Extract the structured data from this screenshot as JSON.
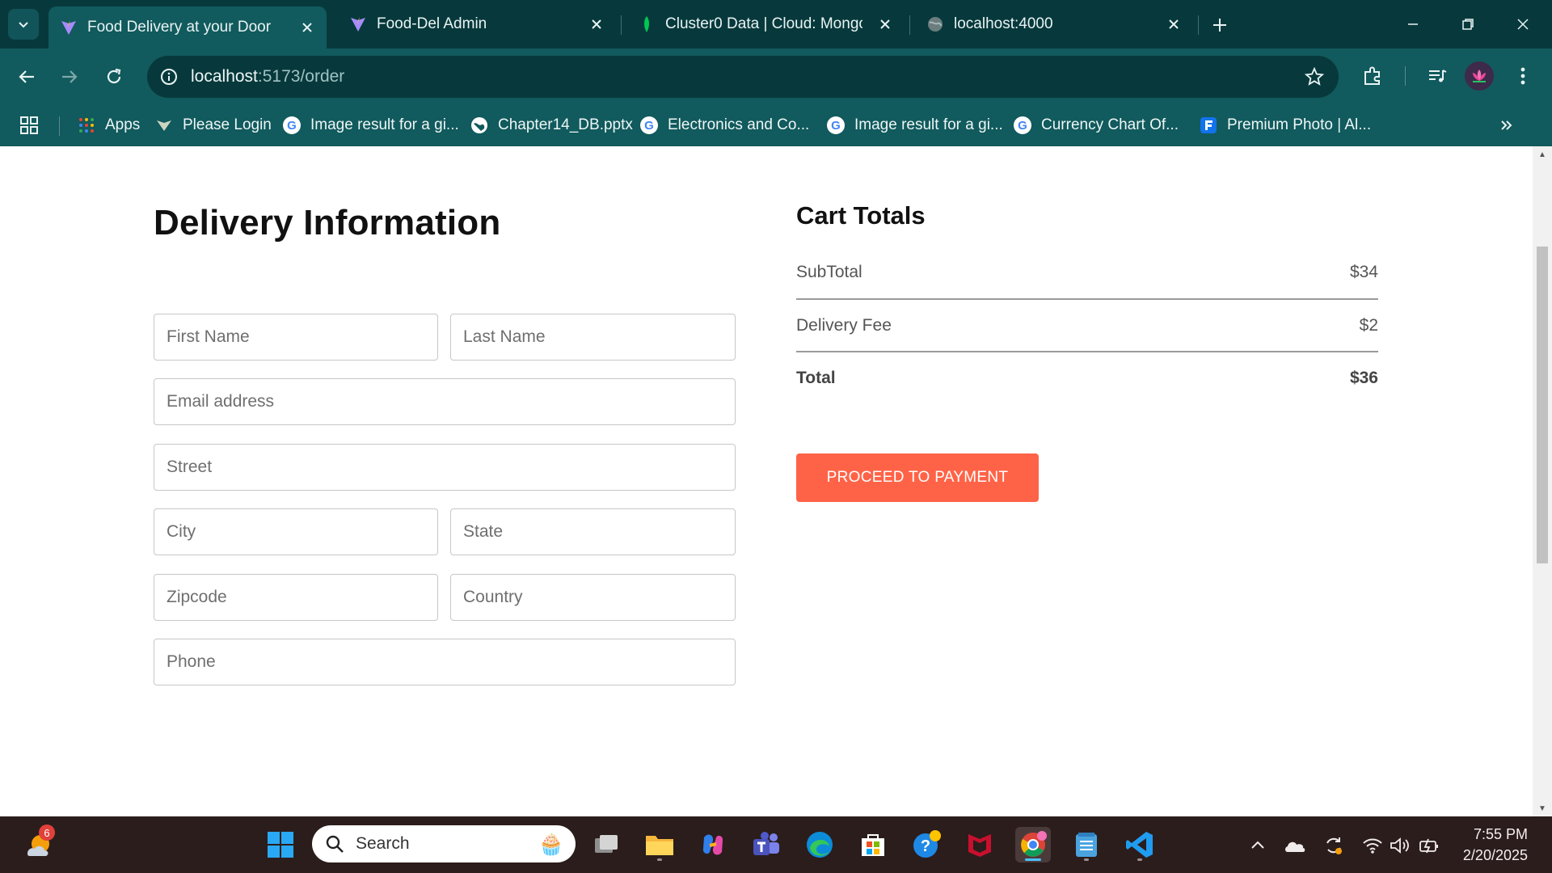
{
  "browser": {
    "tabs": [
      {
        "title": "Food Delivery at your Door",
        "active": true,
        "favicon": "vite-icon"
      },
      {
        "title": "Food-Del Admin",
        "active": false,
        "favicon": "vite-icon"
      },
      {
        "title": "Cluster0 Data | Cloud: MongoDB",
        "active": false,
        "favicon": "mongodb-leaf-icon"
      },
      {
        "title": "localhost:4000",
        "active": false,
        "favicon": "globe-icon"
      }
    ],
    "address": {
      "host": "localhost",
      "path": ":5173/order"
    },
    "bookmarks": [
      {
        "label": "Apps",
        "icon": "apps-grid-icon"
      },
      {
        "label": "Please Login",
        "icon": "vite-icon"
      },
      {
        "label": "Image result for a gi...",
        "icon": "google-icon"
      },
      {
        "label": "Chapter14_DB.pptx",
        "icon": "globe-icon"
      },
      {
        "label": "Electronics and Co...",
        "icon": "google-icon"
      },
      {
        "label": "Image result for a gi...",
        "icon": "google-icon"
      },
      {
        "label": "Currency Chart Of...",
        "icon": "google-icon"
      },
      {
        "label": "Premium Photo | Al...",
        "icon": "freepik-icon"
      }
    ],
    "colors": {
      "tabbar": "#07393c",
      "toolbar": "#115a5d",
      "accent": "#ff6347"
    }
  },
  "delivery": {
    "title": "Delivery Information",
    "fields": {
      "first_name": "First Name",
      "last_name": "Last Name",
      "email": "Email address",
      "street": "Street",
      "city": "City",
      "state": "State",
      "zipcode": "Zipcode",
      "country": "Country",
      "phone": "Phone"
    }
  },
  "cart": {
    "title": "Cart Totals",
    "subtotal_label": "SubTotal",
    "subtotal_value": "$34",
    "delivery_label": "Delivery Fee",
    "delivery_value": "$2",
    "total_label": "Total",
    "total_value": "$36",
    "button_label": "PROCEED TO PAYMENT"
  },
  "taskbar": {
    "search_label": "Search",
    "weather_badge": "6",
    "time": "7:55 PM",
    "date": "2/20/2025"
  }
}
